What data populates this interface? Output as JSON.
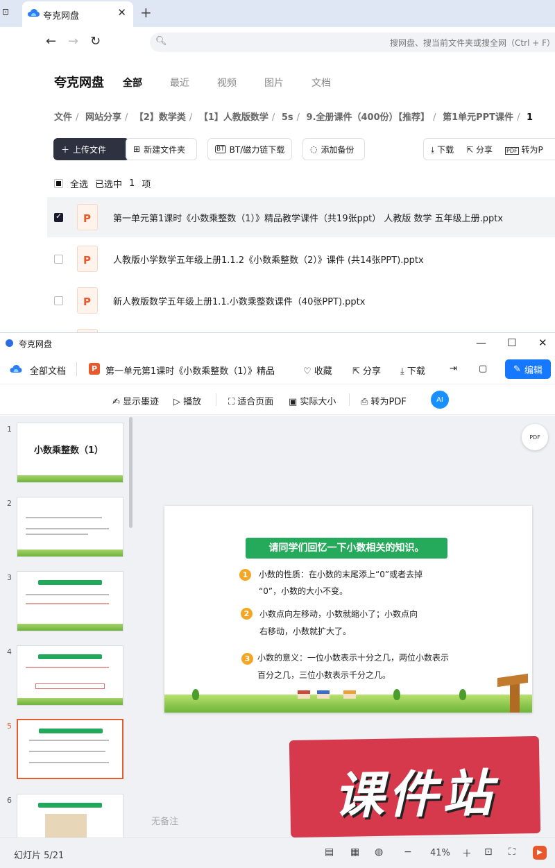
{
  "browser": {
    "tab_title": "夸克网盘",
    "search_placeholder": "搜网盘、搜当前文件夹或搜全网（Ctrl + F）"
  },
  "quark": {
    "brand": "夸克网盘",
    "tabs": [
      "全部",
      "最近",
      "视频",
      "图片",
      "文档"
    ],
    "breadcrumb": [
      "文件",
      "网站分享",
      "【2】数学类",
      "【1】人教版数学",
      "5s",
      "9.全册课件（400份）【推荐】",
      "第1单元PPT课件",
      "1"
    ],
    "buttons": {
      "upload": "上传文件",
      "new_folder": "新建文件夹",
      "bt": "BT/磁力链下载",
      "backup": "添加备份",
      "download": "下载",
      "share": "分享",
      "to_pdf": "转为P"
    },
    "selection": {
      "select_all": "全选",
      "selected": "已选中",
      "count": "1",
      "unit": "项"
    },
    "files": [
      {
        "name": "第一单元第1课时《小数乘整数（1）》精品教学课件（共19张ppt） 人教版 数学 五年级上册.pptx",
        "checked": true
      },
      {
        "name": "人教版小学数学五年级上册1.1.2《小数乘整数（2）》课件 (共14张PPT).pptx",
        "checked": false
      },
      {
        "name": "新人教版数学五年级上册1.1.小数乘整数课件（40张PPT).pptx",
        "checked": false
      }
    ]
  },
  "viewer": {
    "window_title": "夸克网盘",
    "toolbar1": {
      "all_docs": "全部文档",
      "doc_title": "第一单元第1课时《小数乘整数（1）》精品",
      "favorite": "收藏",
      "share": "分享",
      "download": "下载",
      "edit": "编辑"
    },
    "toolbar2": {
      "show_ink": "显示墨迹",
      "play": "播放",
      "fit_page": "适合页面",
      "actual_size": "实际大小",
      "to_pdf": "转为PDF",
      "ai": "AI"
    },
    "thumbnails": [
      "1",
      "2",
      "3",
      "4",
      "5",
      "6"
    ],
    "thumb1_title": "小数乘整数（1）",
    "active_slide": 5,
    "slide": {
      "title": "请同学们回忆一下小数相关的知识。",
      "points": [
        {
          "n": "1",
          "line1": "小数的性质：在小数的末尾添上“0”或者去掉",
          "line2": "“0”，小数的大小不变。"
        },
        {
          "n": "2",
          "line1": "小数点向左移动，小数就缩小了；小数点向",
          "line2": "右移动，小数就扩大了。"
        },
        {
          "n": "3",
          "line1": "小数的意义：一位小数表示十分之几，两位小数表示",
          "line2": "百分之几，三位小数表示千分之几。"
        }
      ]
    },
    "notes_placeholder": "无备注",
    "watermark": "课件站",
    "status": {
      "slide_counter": "幻灯片 5/21",
      "zoom": "41%"
    }
  }
}
